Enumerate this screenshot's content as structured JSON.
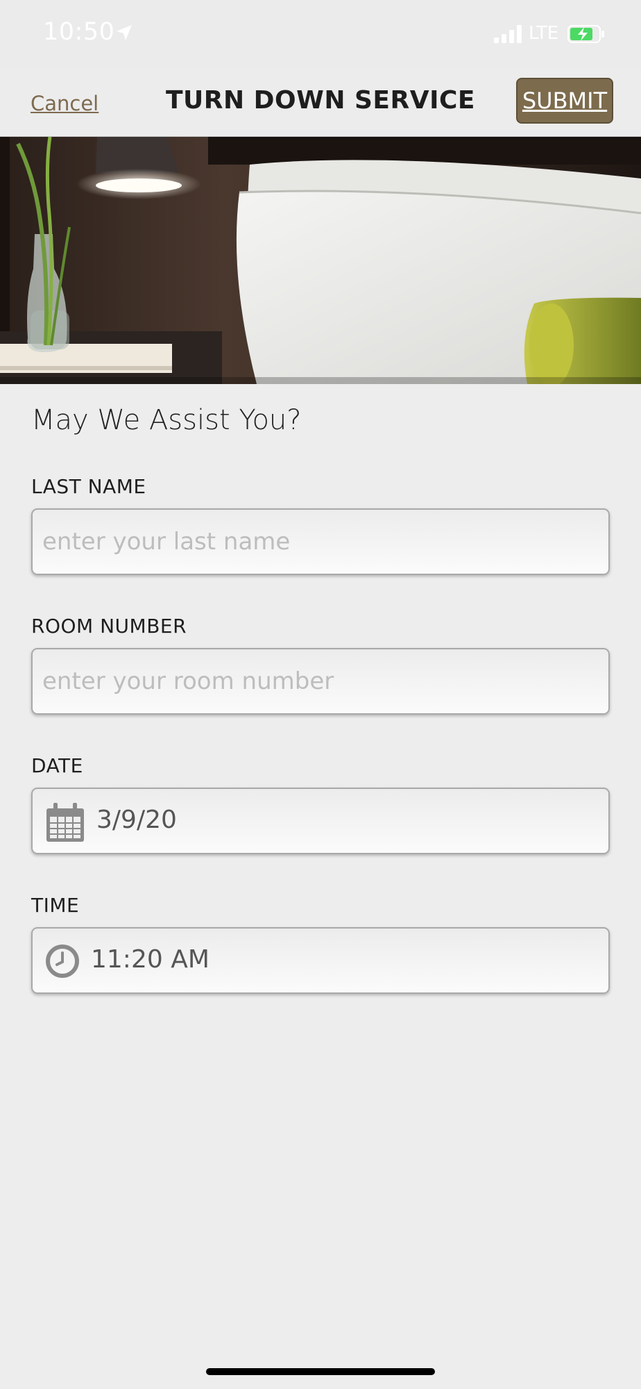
{
  "status_bar": {
    "time": "10:50",
    "network": "LTE",
    "icons": [
      "location-arrow-icon",
      "cellular-signal-icon",
      "battery-charging-icon"
    ]
  },
  "nav": {
    "cancel_label": "Cancel",
    "title": "TURN DOWN SERVICE",
    "submit_label": "SUBMIT"
  },
  "hero": {
    "description_icon": "hotel-bed-photo"
  },
  "form": {
    "heading": "May We Assist You?",
    "last_name": {
      "label": "LAST NAME",
      "placeholder": "enter your last name",
      "value": ""
    },
    "room_number": {
      "label": "ROOM NUMBER",
      "placeholder": "enter your room number",
      "value": ""
    },
    "date": {
      "label": "DATE",
      "value": "3/9/20",
      "icon": "calendar-icon"
    },
    "time": {
      "label": "TIME",
      "value": "11:20 AM",
      "icon": "clock-icon"
    }
  },
  "colors": {
    "background": "#ededed",
    "accent_gold": "#7c6b4c",
    "cancel_link": "#7d6a4f",
    "battery_green": "#4cd964"
  }
}
